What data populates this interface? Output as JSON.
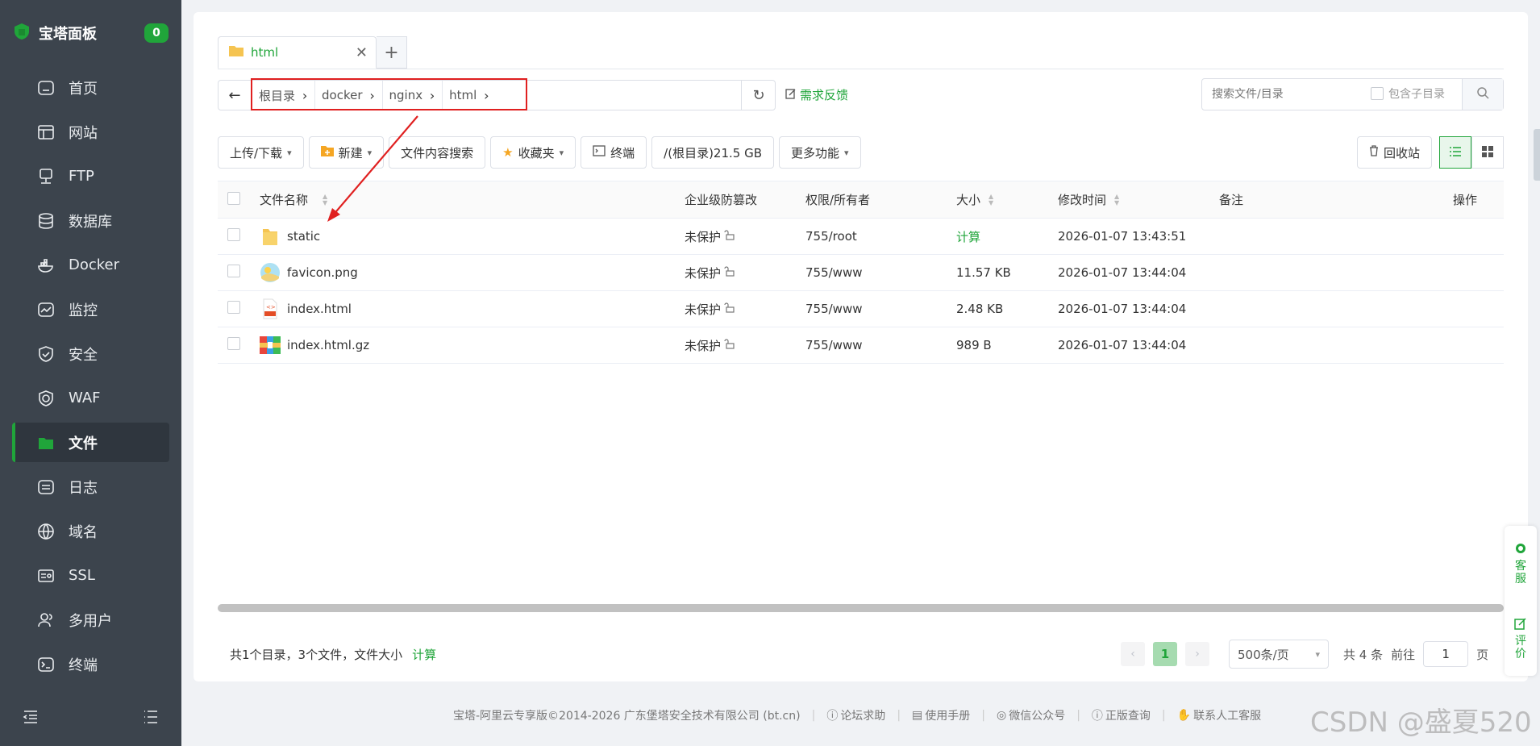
{
  "sidebar": {
    "brand": "宝塔面板",
    "badge": "0",
    "items": [
      {
        "label": "首页",
        "icon": "home-icon"
      },
      {
        "label": "网站",
        "icon": "website-icon"
      },
      {
        "label": "FTP",
        "icon": "ftp-icon"
      },
      {
        "label": "数据库",
        "icon": "database-icon"
      },
      {
        "label": "Docker",
        "icon": "docker-icon"
      },
      {
        "label": "监控",
        "icon": "monitor-icon"
      },
      {
        "label": "安全",
        "icon": "shield-icon"
      },
      {
        "label": "WAF",
        "icon": "waf-icon"
      },
      {
        "label": "文件",
        "icon": "folder-icon",
        "active": true
      },
      {
        "label": "日志",
        "icon": "log-icon"
      },
      {
        "label": "域名",
        "icon": "globe-icon"
      },
      {
        "label": "SSL",
        "icon": "ssl-icon"
      },
      {
        "label": "多用户",
        "icon": "users-icon"
      },
      {
        "label": "终端",
        "icon": "terminal-icon"
      }
    ]
  },
  "tab": {
    "label": "html"
  },
  "address": {
    "crumbs": [
      "根目录",
      "docker",
      "nginx",
      "html"
    ],
    "feedback": "需求反馈"
  },
  "search": {
    "placeholder": "搜索文件/目录",
    "include_sub": "包含子目录"
  },
  "toolbar": {
    "upload": "上传/下载",
    "new": "新建",
    "content_search": "文件内容搜索",
    "favorites": "收藏夹",
    "terminal": "终端",
    "disk": "/(根目录)21.5 GB",
    "more": "更多功能",
    "recycle": "回收站"
  },
  "table": {
    "headers": {
      "name": "文件名称",
      "protect": "企业级防篡改",
      "perm": "权限/所有者",
      "size": "大小",
      "mtime": "修改时间",
      "note": "备注",
      "ops": "操作"
    },
    "rows": [
      {
        "name": "static",
        "type": "folder",
        "protect": "未保护",
        "perm": "755/root",
        "size": "计算",
        "mtime": "2026-01-07 13:43:51"
      },
      {
        "name": "favicon.png",
        "type": "image",
        "protect": "未保护",
        "perm": "755/www",
        "size": "11.57 KB",
        "mtime": "2026-01-07 13:44:04"
      },
      {
        "name": "index.html",
        "type": "html",
        "protect": "未保护",
        "perm": "755/www",
        "size": "2.48 KB",
        "mtime": "2026-01-07 13:44:04"
      },
      {
        "name": "index.html.gz",
        "type": "archive",
        "protect": "未保护",
        "perm": "755/www",
        "size": "989 B",
        "mtime": "2026-01-07 13:44:04"
      }
    ]
  },
  "summary": {
    "text": "共1个目录，3个文件，文件大小",
    "calc": "计算"
  },
  "pager": {
    "current": "1",
    "page_size": "500条/页",
    "total": "共 4 条",
    "goto": "前往",
    "goto_value": "1",
    "page_unit": "页"
  },
  "float": {
    "service": "客服",
    "review": "评价"
  },
  "footer": {
    "copyright": "宝塔-阿里云专享版©2014-2026 广东堡塔安全技术有限公司 (bt.cn)",
    "links": [
      "论坛求助",
      "使用手册",
      "微信公众号",
      "正版查询",
      "联系人工客服"
    ]
  },
  "watermark": "CSDN @盛夏520",
  "colors": {
    "accent": "#20a53a",
    "sidebar": "#3c444d",
    "annotation": "#e02020"
  }
}
